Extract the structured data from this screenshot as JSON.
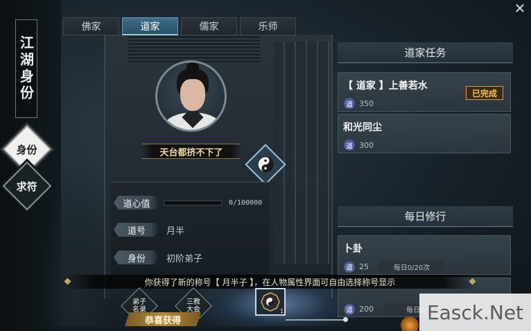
{
  "window": {
    "close_glyph": "✕"
  },
  "sidebar": {
    "title": "江湖身份",
    "nav": [
      {
        "label": "身份",
        "active": true
      },
      {
        "label": "求符",
        "active": false
      }
    ]
  },
  "tabs": [
    {
      "label": "佛家",
      "active": false
    },
    {
      "label": "道家",
      "active": true
    },
    {
      "label": "儒家",
      "active": false
    },
    {
      "label": "乐师",
      "active": false
    }
  ],
  "character": {
    "nameplate": "天台都挤不下了",
    "icon": "taiji-icon"
  },
  "stats": {
    "daoxin": {
      "label": "道心值",
      "value": "0/100000",
      "fraction": 0
    },
    "title": {
      "label": "道号",
      "value": "月半"
    },
    "rank": {
      "label": "身份",
      "value": "初阶弟子"
    }
  },
  "quests": {
    "header": "道家任务",
    "items": [
      {
        "title": "【 道家 】上善若水",
        "reward": "350",
        "reward_icon": "道",
        "status": "已完成"
      },
      {
        "title": "和光同尘",
        "reward": "300",
        "reward_icon": "道",
        "status": ""
      }
    ]
  },
  "daily": {
    "header": "每日修行",
    "items": [
      {
        "title": "卜卦",
        "reward": "25",
        "reward_icon": "道",
        "count": "每日0/20次"
      },
      {
        "title": "",
        "reward": "200",
        "reward_icon": "道",
        "count": "每日0/"
      }
    ]
  },
  "notice": {
    "text": "你获得了新的称号【 月半子 】，在人物属性界面可自由选择称号显示"
  },
  "bottom": {
    "btn1": "弟子名录",
    "btn2": "三教大会",
    "center_number": "1",
    "ribbon": "恭喜获得"
  },
  "watermark": "Easck.Net",
  "colors": {
    "accent_tab": "#3f6d8a",
    "done_badge": "#d49b38",
    "dao_icon": "#4e5d9a"
  }
}
